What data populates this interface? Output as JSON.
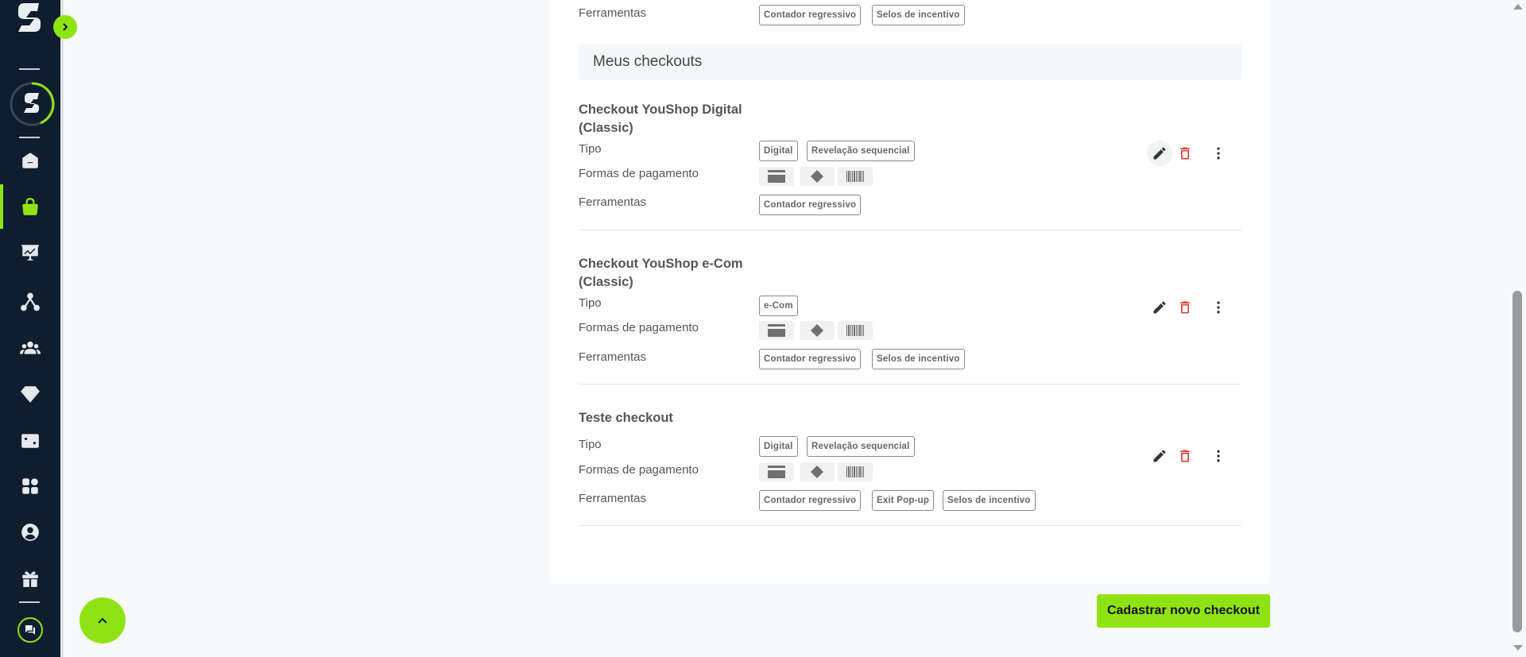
{
  "sidebar": {
    "items": [
      {
        "name": "home-icon",
        "active": false
      },
      {
        "name": "shopping-bag-icon",
        "active": true
      },
      {
        "name": "presentation-chart-icon",
        "active": false
      },
      {
        "name": "network-icon",
        "active": false
      },
      {
        "name": "users-group-icon",
        "active": false
      },
      {
        "name": "diamond-icon",
        "active": false
      },
      {
        "name": "dice-icon",
        "active": false
      },
      {
        "name": "apps-grid-icon",
        "active": false
      },
      {
        "name": "user-circle-icon",
        "active": false
      },
      {
        "name": "gift-icon",
        "active": false
      }
    ]
  },
  "top_row": {
    "label": "Ferramentas",
    "tags": [
      "Contador regressivo",
      "Selos de incentivo"
    ]
  },
  "section": {
    "title": "Meus checkouts"
  },
  "labels": {
    "tipo": "Tipo",
    "pagamento": "Formas de pagamento",
    "ferramentas": "Ferramentas"
  },
  "checkouts": [
    {
      "title_line1": "Checkout YouShop Digital",
      "title_line2": "(Classic)",
      "tipo": [
        "Digital",
        "Revelação sequencial"
      ],
      "payments": [
        "credit-card-icon",
        "pix-icon",
        "barcode-icon"
      ],
      "ferramentas": [
        "Contador regressivo"
      ]
    },
    {
      "title_line1": "Checkout YouShop e-Com",
      "title_line2": "(Classic)",
      "tipo": [
        "e-Com"
      ],
      "payments": [
        "credit-card-icon",
        "pix-icon",
        "barcode-icon"
      ],
      "ferramentas": [
        "Contador regressivo",
        "Selos de incentivo"
      ]
    },
    {
      "title_line1": "Teste checkout",
      "title_line2": "",
      "tipo": [
        "Digital",
        "Revelação sequencial"
      ],
      "payments": [
        "credit-card-icon",
        "pix-icon",
        "barcode-icon"
      ],
      "ferramentas": [
        "Contador regressivo",
        "Exit Pop-up",
        "Selos de incentivo"
      ]
    }
  ],
  "buttons": {
    "new_checkout": "Cadastrar novo checkout"
  },
  "colors": {
    "accent": "#8fe314",
    "sidebar": "#0f1d2e",
    "delete": "#e53935"
  }
}
